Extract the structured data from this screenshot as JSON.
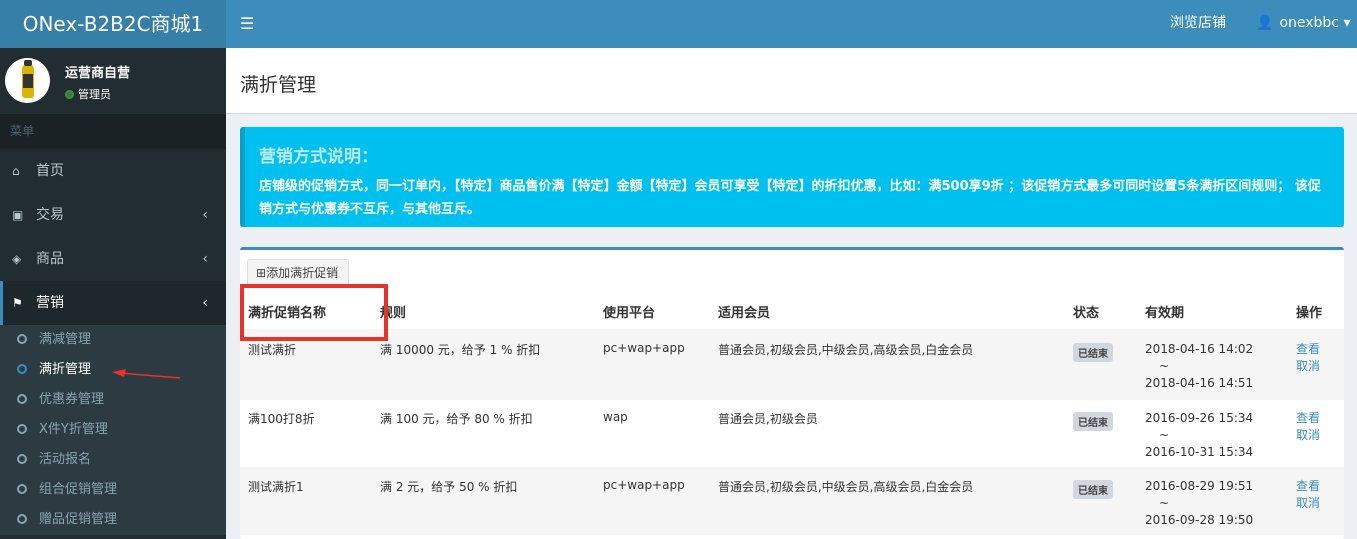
{
  "app_title": "ONex-B2B2C商城1",
  "user_panel": {
    "name": "运营商自营",
    "role": "管理员"
  },
  "menu_header": "菜单",
  "nav": [
    {
      "label": "首页",
      "icon": "home-icon"
    },
    {
      "label": "交易",
      "icon": "credit-card-icon"
    },
    {
      "label": "商品",
      "icon": "cube-icon"
    },
    {
      "label": "营销",
      "icon": "tag-icon"
    }
  ],
  "submenu": [
    "满减管理",
    "满折管理",
    "优惠券管理",
    "X件Y折管理",
    "活动报名",
    "组合促销管理",
    "赠品促销管理"
  ],
  "topbar": {
    "browse": "浏览店铺",
    "username": "onexbbc"
  },
  "page_title": "满折管理",
  "callout": {
    "title": "营销方式说明：",
    "text": "店铺级的促销方式，同一订单内，【特定】商品售价满【特定】金额【特定】会员可享受【特定】的折扣优惠，比如：满500享9折 ；该促销方式最多可同时设置5条满折区间规则； 该促销方式与优惠券不互斥，与其他互斥。"
  },
  "add_button": "添加满折促销",
  "table": {
    "headers": [
      "满折促销名称",
      "规则",
      "使用平台",
      "适用会员",
      "状态",
      "有效期",
      "操作"
    ],
    "rows": [
      {
        "name": "测试满折",
        "rule": "满 10000 元，给予 1 % 折扣",
        "platform": "pc+wap+app",
        "members": "普通会员,初级会员,中级会员,高级会员,白金会员",
        "status": "已结束",
        "start": "2018-04-16 14:02",
        "sep": "~",
        "end": "2018-04-16 14:51",
        "view": "查看",
        "cancel": "取消"
      },
      {
        "name": "满100打8折",
        "rule": "满 100 元，给予 80 % 折扣",
        "platform": "wap",
        "members": "普通会员,初级会员",
        "status": "已结束",
        "start": "2016-09-26 15:34",
        "sep": "~",
        "end": "2016-10-31 15:34",
        "view": "查看",
        "cancel": "取消"
      },
      {
        "name": "测试满折1",
        "rule": "满 2 元，给予 50 % 折扣",
        "platform": "pc+wap+app",
        "members": "普通会员,初级会员,中级会员,高级会员,白金会员",
        "status": "已结束",
        "start": "2016-08-29 19:51",
        "sep": "~",
        "end": "2016-09-28 19:50",
        "view": "查看",
        "cancel": "取消"
      }
    ]
  }
}
